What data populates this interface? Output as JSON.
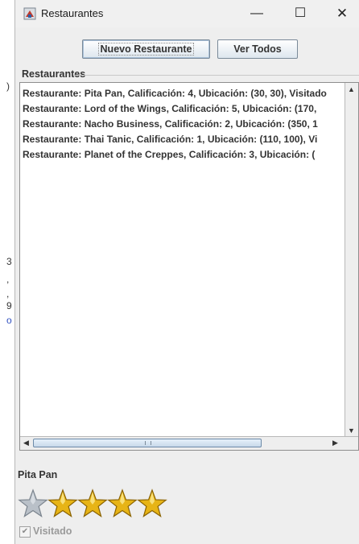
{
  "window": {
    "title": "Restaurantes",
    "controls": {
      "minimize": "—",
      "maximize": "☐",
      "close": "✕"
    }
  },
  "toolbar": {
    "new_label": "Nuevo Restaurante",
    "view_all_label": "Ver Todos"
  },
  "group": {
    "title": "Restaurantes"
  },
  "list": {
    "items": [
      "Restaurante: Pita Pan, Calificación: 4, Ubicación: (30, 30), Visitado",
      "Restaurante: Lord of the Wings, Calificación: 5, Ubicación: (170, ",
      "Restaurante: Nacho Business, Calificación: 2, Ubicación: (350, 1",
      "Restaurante: Thai Tanic, Calificación: 1, Ubicación: (110, 100), Vi",
      "Restaurante: Planet of the Creppes, Calificación: 3, Ubicación: ("
    ]
  },
  "detail": {
    "name": "Pita Pan",
    "rating": 4,
    "max_rating": 5,
    "visited_label": "Visitado",
    "visited": true
  },
  "background": {
    "fragments": [
      ")",
      "3",
      ",",
      ",",
      "9",
      "o"
    ]
  },
  "colors": {
    "star_gold": "#e7b416",
    "star_empty": "#b9c0c8",
    "accent": "#6c8aa8"
  }
}
